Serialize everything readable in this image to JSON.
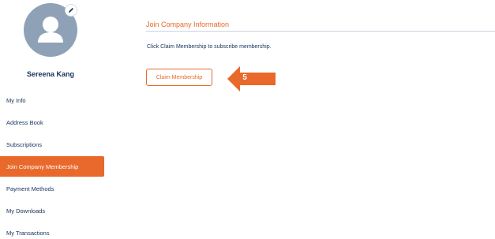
{
  "profile": {
    "name": "Sereena Kang",
    "avatar_icon": "user-avatar-icon",
    "edit_icon": "pencil-icon"
  },
  "sidebar": {
    "items": [
      {
        "label": "My Info",
        "active": false
      },
      {
        "label": "Address Book",
        "active": false
      },
      {
        "label": "Subscriptions",
        "active": false
      },
      {
        "label": "Join Company Membership",
        "active": true
      },
      {
        "label": "Payment Methods",
        "active": false
      },
      {
        "label": "My Downloads",
        "active": false
      },
      {
        "label": "My Transactions",
        "active": false
      }
    ]
  },
  "main": {
    "section_title": "Join Company Information",
    "instruction": "Click Claim Membership to subscribe membership.",
    "claim_button_label": "Claim Membership"
  },
  "callout": {
    "step_number": "5",
    "icon": "left-arrow-icon"
  },
  "colors": {
    "accent": "#e8692b",
    "text": "#16325c",
    "avatar_bg": "#8fa1b7",
    "rule": "#c9d3df"
  }
}
